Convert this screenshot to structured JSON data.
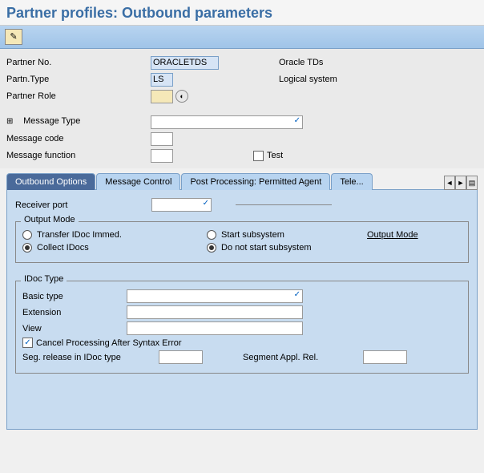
{
  "title": "Partner profiles: Outbound parameters",
  "partner": {
    "no_label": "Partner No.",
    "no_value": "ORACLETDS",
    "no_desc": "Oracle TDs",
    "type_label": "Partn.Type",
    "type_value": "LS",
    "type_desc": "Logical system",
    "role_label": "Partner Role",
    "role_value": ""
  },
  "message": {
    "type_label": "Message Type",
    "type_value": "",
    "code_label": "Message code",
    "code_value": "",
    "func_label": "Message function",
    "func_value": "",
    "test_label": "Test"
  },
  "tabs": {
    "t1": "Outbound Options",
    "t2": "Message Control",
    "t3": "Post Processing: Permitted Agent",
    "t4": "Tele..."
  },
  "outbound": {
    "recv_port_label": "Receiver port",
    "recv_port_value": "",
    "output_mode_title": "Output Mode",
    "transfer_immed": "Transfer IDoc Immed.",
    "collect": "Collect IDocs",
    "start_sub": "Start subsystem",
    "no_start_sub": "Do not start subsystem",
    "output_mode_link": "Output Mode",
    "idoc_type_title": "IDoc Type",
    "basic_type_label": "Basic type",
    "basic_type_value": "",
    "extension_label": "Extension",
    "extension_value": "",
    "view_label": "View",
    "view_value": "",
    "cancel_label": "Cancel Processing After Syntax Error",
    "seg_release_label": "Seg. release in IDoc type",
    "seg_release_value": "",
    "seg_appl_label": "Segment Appl. Rel.",
    "seg_appl_value": ""
  }
}
